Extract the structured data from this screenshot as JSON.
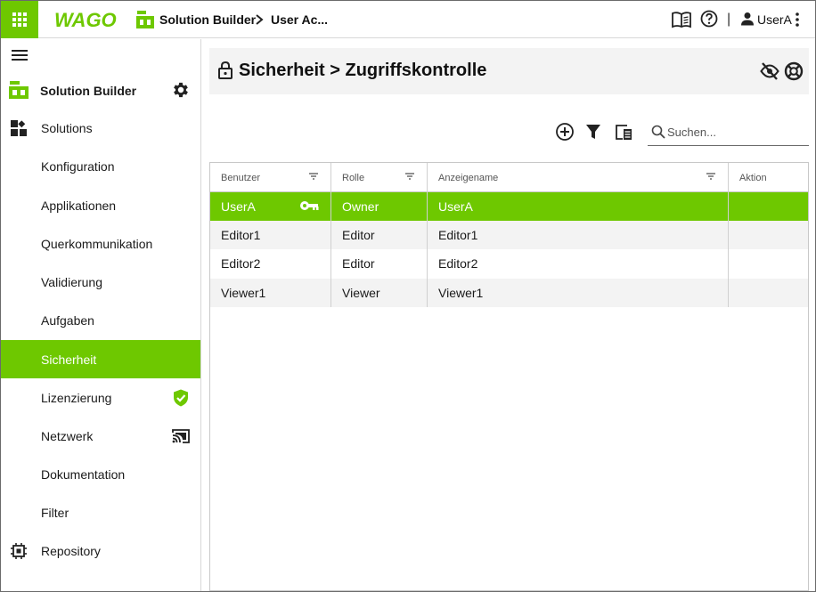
{
  "topbar": {
    "logo_text": "WAGO",
    "breadcrumb": [
      "Solution Builder",
      "User Ac..."
    ],
    "user": "UserA",
    "divider": "|"
  },
  "sidebar": {
    "header_title": "Solution Builder",
    "items": [
      {
        "label": "Solutions",
        "icon": "dashboard-icon"
      },
      {
        "label": "Konfiguration"
      },
      {
        "label": "Applikationen"
      },
      {
        "label": "Querkommunikation"
      },
      {
        "label": "Validierung"
      },
      {
        "label": "Aufgaben"
      },
      {
        "label": "Sicherheit",
        "active": true
      },
      {
        "label": "Lizenzierung",
        "trail_icon": "shield-check-icon"
      },
      {
        "label": "Netzwerk",
        "trail_icon": "cast-icon"
      },
      {
        "label": "Dokumentation"
      },
      {
        "label": "Filter"
      },
      {
        "label": "Repository",
        "icon": "chip-icon"
      }
    ]
  },
  "page": {
    "title": "Sicherheit > Zugriffskontrolle"
  },
  "toolbar": {
    "search_placeholder": "Suchen..."
  },
  "table": {
    "columns": [
      "Benutzer",
      "Rolle",
      "Anzeigename",
      "Aktion"
    ],
    "rows": [
      {
        "user": "UserA",
        "role": "Owner",
        "display": "UserA",
        "selected": true
      },
      {
        "user": "Editor1",
        "role": "Editor",
        "display": "Editor1"
      },
      {
        "user": "Editor2",
        "role": "Editor",
        "display": "Editor2"
      },
      {
        "user": "Viewer1",
        "role": "Viewer",
        "display": "Viewer1"
      }
    ]
  },
  "colors": {
    "accent": "#6ec800",
    "row_alt": "#f3f3f3",
    "header_bg": "#f3f3f3"
  }
}
